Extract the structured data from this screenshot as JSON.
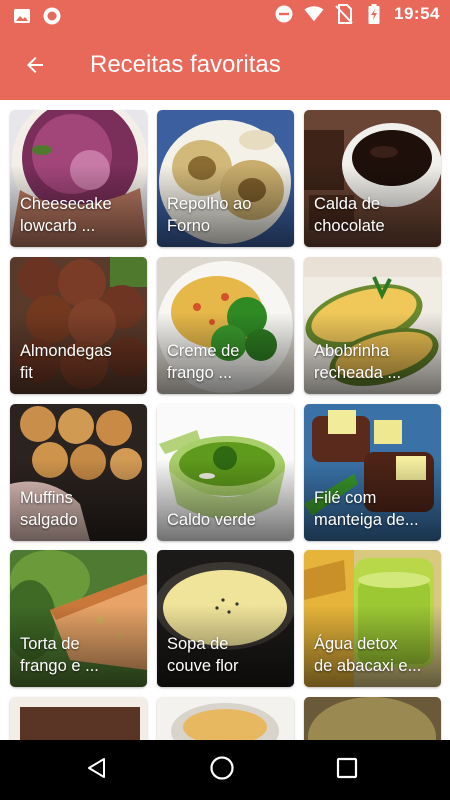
{
  "status_bar": {
    "time": "19:54",
    "icons": [
      "image-icon",
      "record-icon",
      "do-not-disturb-icon",
      "wifi-icon",
      "no-sim-icon",
      "battery-charging-icon"
    ]
  },
  "app_bar": {
    "title": "Receitas favoritas",
    "back_icon": "arrow-back-icon",
    "color": "#e8685a"
  },
  "recipes": [
    {
      "line1": "Cheesecake",
      "line2": "lowcarb ..."
    },
    {
      "line1": "Repolho ao",
      "line2": "Forno"
    },
    {
      "line1": "Calda de",
      "line2": "chocolate"
    },
    {
      "line1": "Almondegas",
      "line2": "fit"
    },
    {
      "line1": "Creme de",
      "line2": "frango ..."
    },
    {
      "line1": "Abobrinha",
      "line2": "recheada ..."
    },
    {
      "line1": "Muffins",
      "line2": "salgado"
    },
    {
      "line1": "",
      "line2": "Caldo verde"
    },
    {
      "line1": "Filé com",
      "line2": "manteiga de..."
    },
    {
      "line1": "Torta de",
      "line2": "frango e ..."
    },
    {
      "line1": "Sopa de",
      "line2": "couve flor"
    },
    {
      "line1": "Água detox",
      "line2": "de abacaxi e..."
    },
    {
      "line1": "",
      "line2": ""
    },
    {
      "line1": "",
      "line2": ""
    },
    {
      "line1": "",
      "line2": ""
    }
  ],
  "nav_bar": {
    "icons": [
      "back-triangle-icon",
      "home-circle-icon",
      "recents-square-icon"
    ]
  }
}
